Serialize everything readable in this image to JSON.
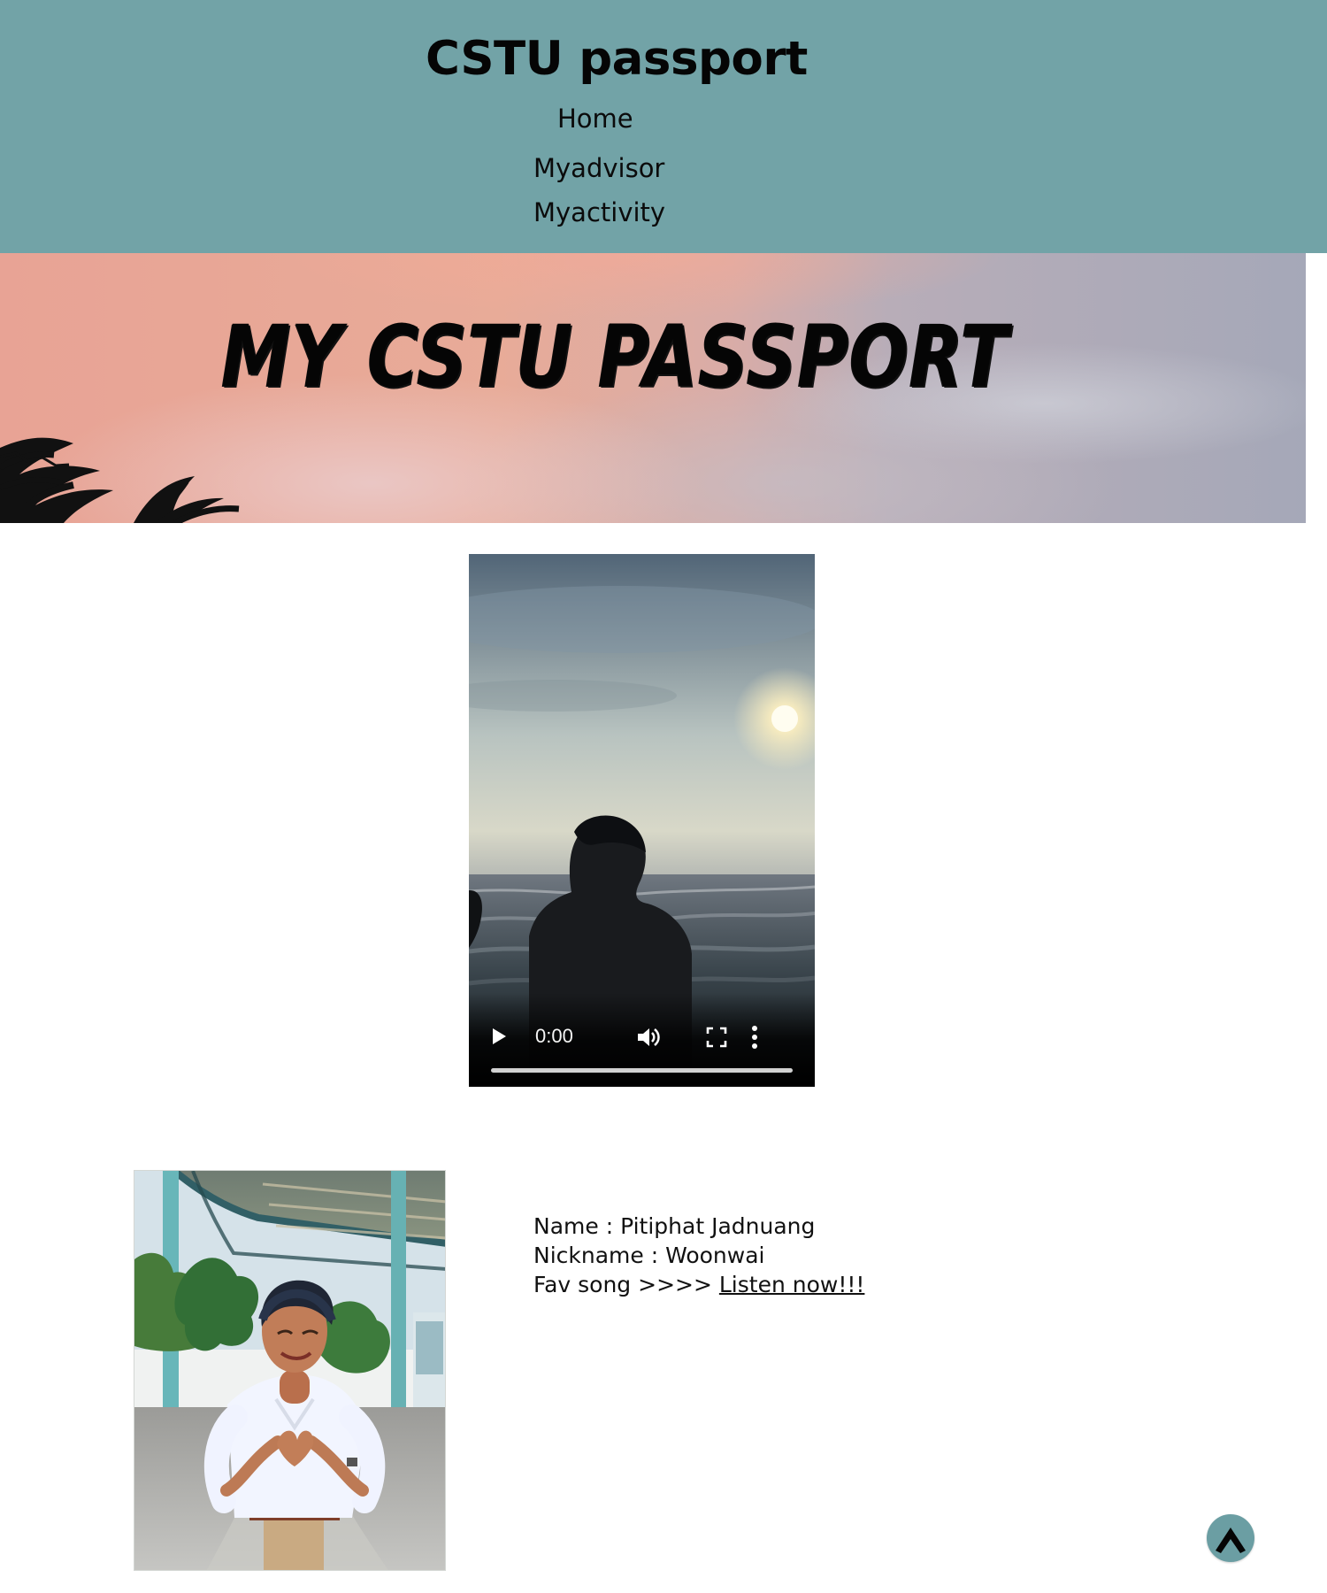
{
  "header": {
    "title": "CSTU passport",
    "nav": {
      "home": "Home",
      "advisor": "Myadvisor",
      "activity": "Myactivity"
    },
    "background_color": "#72a3a7"
  },
  "banner": {
    "title": "MY CSTU PASSPORT",
    "colors": {
      "sunset": "#e8a395",
      "cloud": "#a5a8b8",
      "text": "#050505"
    }
  },
  "video": {
    "time": "0:00",
    "progress": 0,
    "icons": [
      "play-icon",
      "volume-icon",
      "fullscreen-icon",
      "more-vertical-icon"
    ]
  },
  "profile": {
    "name": "Name : Pitiphat Jadnuang",
    "nickname": "Nickname : Woonwai",
    "fav_song_prefix": "Fav song >>>> ",
    "fav_song_link": "Listen now!!!"
  },
  "floating": {
    "back_to_top_icon": "chevron-up-icon",
    "color": "#6b9ea3"
  }
}
